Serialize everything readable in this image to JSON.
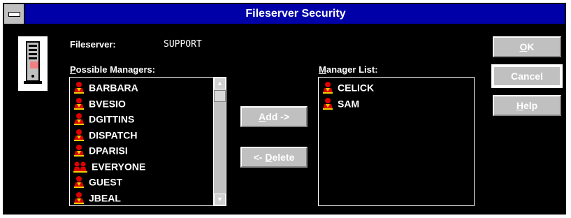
{
  "window": {
    "title": "Fileserver Security"
  },
  "fileserver": {
    "label": "Fileserver:",
    "value": "SUPPORT"
  },
  "possible_managers": {
    "label_access": "P",
    "label_rest": "ossible Managers:",
    "items": [
      {
        "name": "BARBARA",
        "icon": "user-icon"
      },
      {
        "name": "BVESIO",
        "icon": "user-icon"
      },
      {
        "name": "DGITTINS",
        "icon": "user-icon"
      },
      {
        "name": "DISPATCH",
        "icon": "user-icon"
      },
      {
        "name": "DPARISI",
        "icon": "user-icon"
      },
      {
        "name": "EVERYONE",
        "icon": "group-icon"
      },
      {
        "name": "GUEST",
        "icon": "user-icon"
      },
      {
        "name": "JBEAL",
        "icon": "user-icon"
      }
    ]
  },
  "manager_list": {
    "label_access": "M",
    "label_rest": "anager List:",
    "items": [
      {
        "name": "CELICK",
        "icon": "user-icon"
      },
      {
        "name": "SAM",
        "icon": "user-icon"
      }
    ]
  },
  "buttons": {
    "add_access": "A",
    "add_rest": "dd ->",
    "delete_prefix": "<- ",
    "delete_access": "D",
    "delete_rest": "elete",
    "ok_access": "O",
    "ok_rest": "K",
    "cancel": "Cancel",
    "help_access": "H",
    "help_rest": "elp"
  },
  "colors": {
    "title_bar": "#0000a8",
    "button_face": "#c0c0c0",
    "icon_red": "#e00000",
    "icon_yellow": "#f0d000"
  }
}
